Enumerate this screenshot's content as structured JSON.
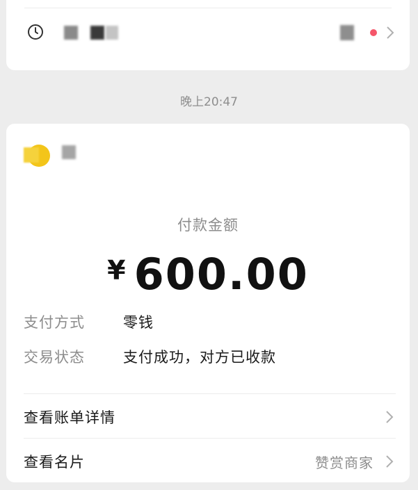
{
  "previous_message": {
    "icon": "clock-icon",
    "unread_dot_color": "#f5566a"
  },
  "timestamp": "晚上20:47",
  "payment_card": {
    "merchant_icon": "merchant-logo",
    "payment_label": "付款金额",
    "currency_symbol": "¥",
    "amount": "600.00",
    "details": [
      {
        "key": "支付方式",
        "value": "零钱"
      },
      {
        "key": "交易状态",
        "value": "支付成功，对方已收款"
      }
    ],
    "links": [
      {
        "label": "查看账单详情",
        "extra": ""
      },
      {
        "label": "查看名片",
        "extra": "赞赏商家"
      }
    ]
  }
}
